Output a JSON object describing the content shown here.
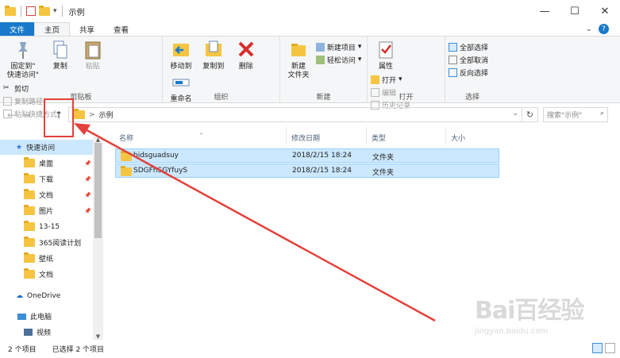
{
  "window": {
    "title": "示例",
    "quick_access_dropdown": "▾"
  },
  "window_controls": {
    "minimize": "—",
    "maximize": "☐",
    "close": "✕"
  },
  "tabs": {
    "file": "文件",
    "home": "主页",
    "share": "共享",
    "view": "查看"
  },
  "ribbon": {
    "clipboard": {
      "pin_label_1": "固定到\"",
      "pin_label_2": "快速访问\"",
      "copy": "复制",
      "paste": "粘贴",
      "cut": "剪切",
      "copy_path": "复制路径",
      "paste_shortcut": "粘贴快捷方式",
      "group_label": "剪贴板"
    },
    "organize": {
      "move_to": "移动到",
      "copy_to": "复制到",
      "delete": "删除",
      "rename": "重命名",
      "group_label": "组织"
    },
    "new": {
      "new_folder_1": "新建",
      "new_folder_2": "文件夹",
      "new_item": "新建项目",
      "easy_access": "轻松访问",
      "group_label": "新建"
    },
    "open": {
      "properties": "属性",
      "open": "打开",
      "edit": "编辑",
      "history": "历史记录",
      "group_label": "打开"
    },
    "select": {
      "select_all": "全部选择",
      "select_none": "全部取消",
      "invert": "反向选择",
      "group_label": "选择"
    }
  },
  "address": {
    "path_separator": ">",
    "path": "示例",
    "search_placeholder": "搜索\"示例\""
  },
  "nav_pane": {
    "quick_access": "快速访问",
    "items": [
      {
        "label": "桌面",
        "pinned": true
      },
      {
        "label": "下载",
        "pinned": true
      },
      {
        "label": "文档",
        "pinned": true
      },
      {
        "label": "图片",
        "pinned": true
      },
      {
        "label": "13-15",
        "pinned": false
      },
      {
        "label": "365阅读计划",
        "pinned": false
      },
      {
        "label": "壁纸",
        "pinned": false
      },
      {
        "label": "文档",
        "pinned": false
      }
    ],
    "onedrive": "OneDrive",
    "this_pc": "此电脑",
    "videos": "视频"
  },
  "file_list": {
    "columns": {
      "name": "名称",
      "modified": "修改日期",
      "type": "类型",
      "size": "大小"
    },
    "rows": [
      {
        "name": "bidsguadsuy",
        "modified": "2018/2/15 18:24",
        "type": "文件夹",
        "size": ""
      },
      {
        "name": "SDGFhSGYfuyS",
        "modified": "2018/2/15 18:24",
        "type": "文件夹",
        "size": ""
      }
    ]
  },
  "status_bar": {
    "item_count": "2 个项目",
    "selected_count": "已选择 2 个项目"
  },
  "watermark": {
    "brand": "Bai百经验",
    "url": "jingyan.baidu.com"
  },
  "colors": {
    "accent": "#1979ca",
    "selection": "#cce8ff",
    "annotation_red": "#e3413b"
  }
}
